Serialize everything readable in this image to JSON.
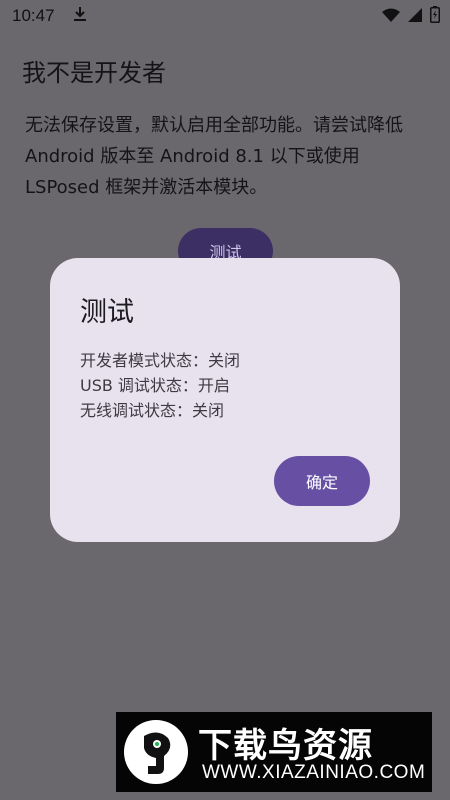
{
  "status_bar": {
    "time": "10:47",
    "icons": [
      "download-icon",
      "wifi-icon",
      "signal-icon",
      "battery-charging-icon"
    ]
  },
  "app": {
    "title": "我不是开发者",
    "description": "无法保存设置，默认启用全部功能。请尝试降低 Android 版本至 Android 8.1 以下或使用 LSPosed 框架并激活本模块。",
    "test_button_label": "测试"
  },
  "dialog": {
    "title": "测试",
    "lines": [
      "开发者模式状态：关闭",
      "USB 调试状态：开启",
      "无线调试状态：关闭"
    ],
    "confirm_label": "确定"
  },
  "watermark": {
    "title": "下载鸟资源",
    "url": "WWW.XIAZAINIAO.COM"
  },
  "colors": {
    "scrim_background": "#6b686d",
    "dialog_surface": "#e8e1ee",
    "primary": "#6750a4",
    "bg_button": "#3b2f63"
  }
}
